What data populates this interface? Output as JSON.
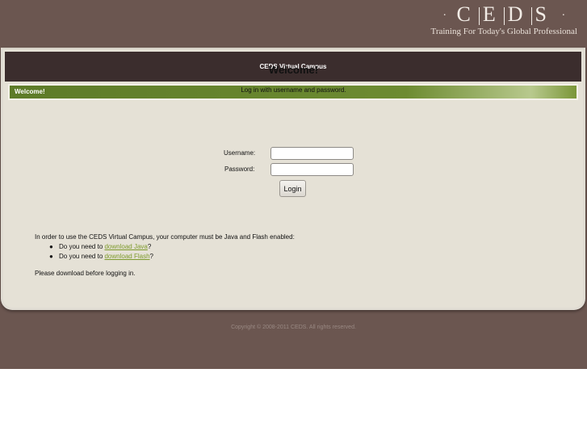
{
  "header": {
    "logo_letters": [
      "C",
      "E",
      "D",
      "S"
    ],
    "logo_dot": "·",
    "tagline": "Training For Today's Global Professional"
  },
  "panel": {
    "title": "CEDS Virtual Campus",
    "welcome_tab": "Welcome!"
  },
  "login": {
    "heading": "Welcome!",
    "instructions": "Log in with username and password.",
    "username_label": "Username:",
    "username_value": "",
    "password_label": "Password:",
    "password_value": "",
    "login_button": "Login"
  },
  "requirements": {
    "intro": "In order to use the CEDS Virtual Campus, your computer must be Java and Flash enabled:",
    "items": [
      {
        "prefix": "Do you need to ",
        "link": "download Java",
        "suffix": "?"
      },
      {
        "prefix": "Do you need to ",
        "link": "download Flash",
        "suffix": "?"
      }
    ],
    "bullet": "●",
    "outro": "Please download before logging in."
  },
  "footer": {
    "copyright": "Copyright © 2008-2011 CEDS. All rights reserved."
  },
  "colors": {
    "page_background": "#6b5650",
    "title_bar": "#3b2d2d",
    "welcome_bar": "#6d8b31",
    "content_background": "#e5e1d6",
    "link": "#7d9a2c"
  }
}
